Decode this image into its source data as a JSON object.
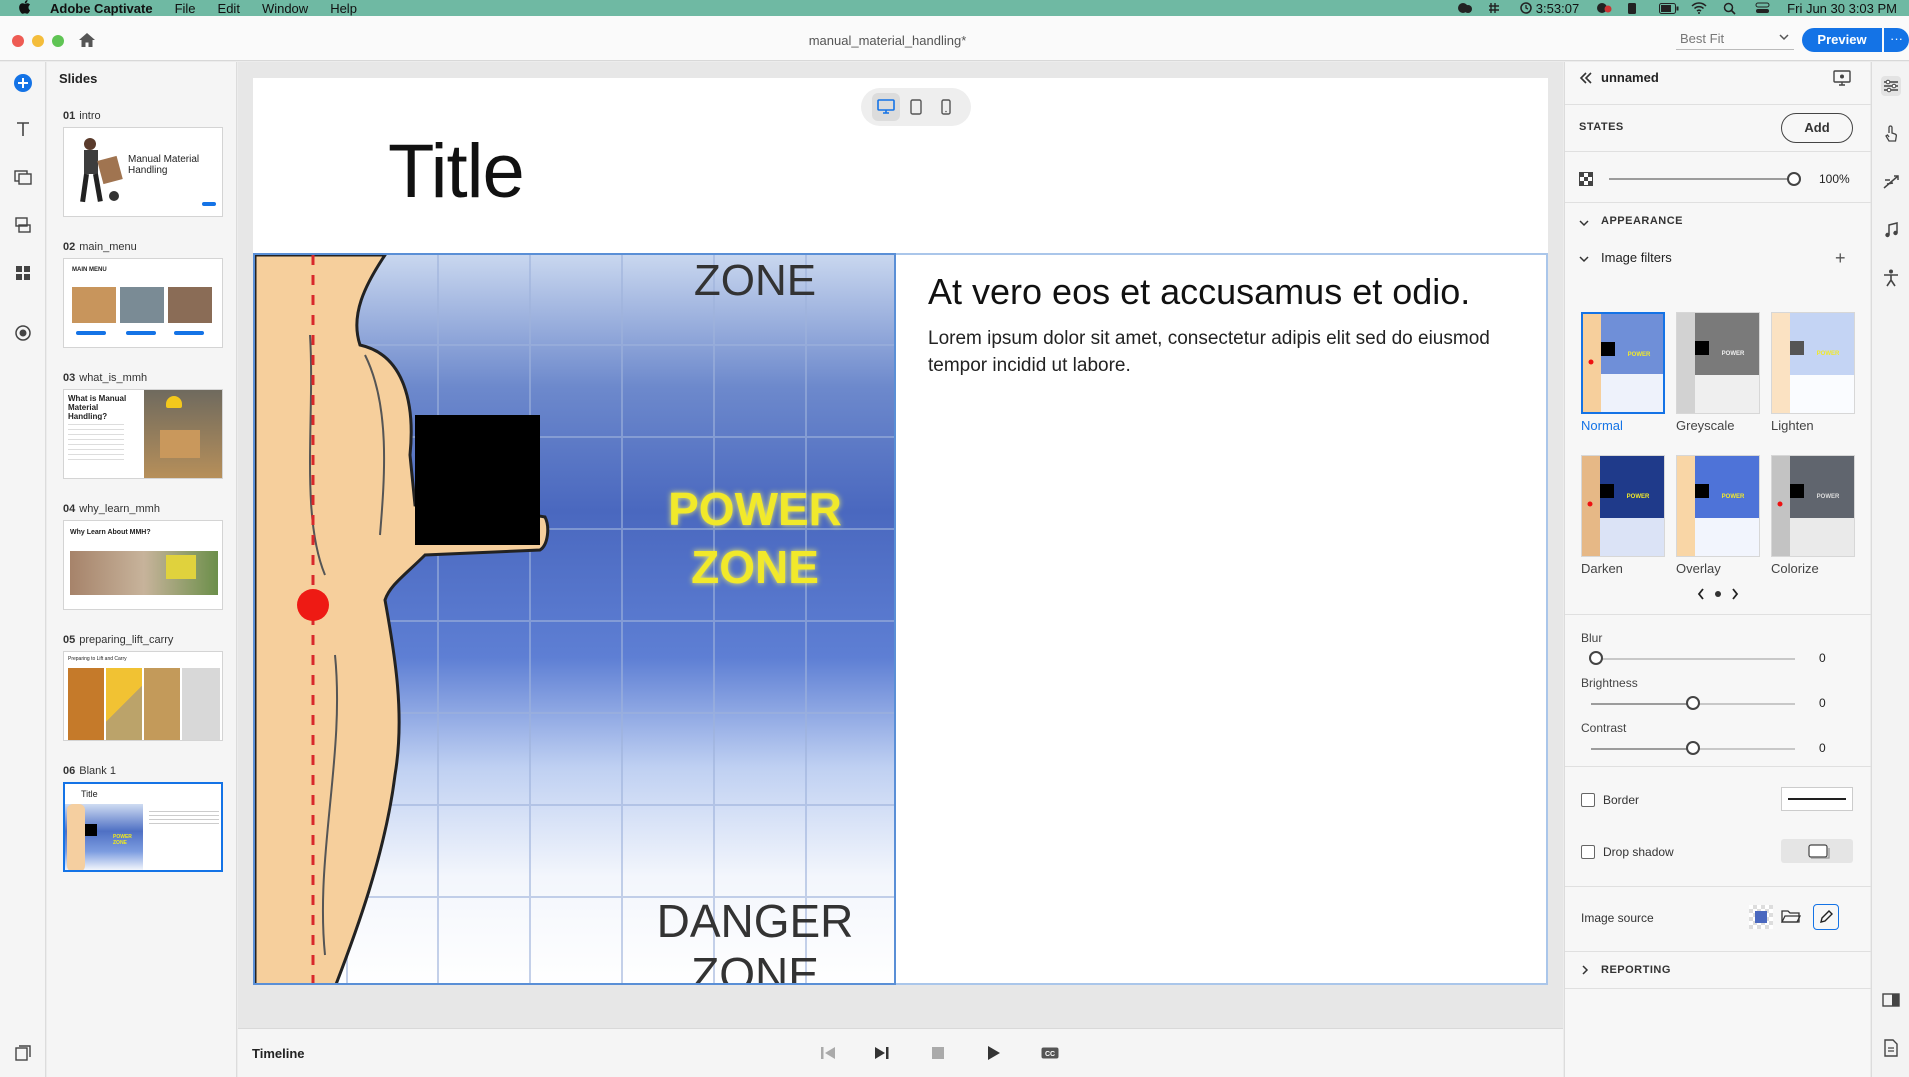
{
  "menubar": {
    "app_name": "Adobe Captivate",
    "menus": [
      "File",
      "Edit",
      "Window",
      "Help"
    ],
    "clock_timer": "3:53:07",
    "datetime": "Fri Jun 30  3:03 PM"
  },
  "window": {
    "doc_title": "manual_material_handling*",
    "zoom": "Best Fit",
    "preview_label": "Preview",
    "more_label": "···"
  },
  "slides_panel": {
    "title": "Slides",
    "slides": [
      {
        "num": "01",
        "name": "intro",
        "thumb_text": "Manual Material Handling"
      },
      {
        "num": "02",
        "name": "main_menu",
        "thumb_text": "MAIN MENU"
      },
      {
        "num": "03",
        "name": "what_is_mmh",
        "thumb_text": "What is Manual Material Handling?"
      },
      {
        "num": "04",
        "name": "why_learn_mmh",
        "thumb_text": "Why Learn About MMH?"
      },
      {
        "num": "05",
        "name": "preparing_lift_carry",
        "thumb_text": "Preparing to Lift and Carry"
      },
      {
        "num": "06",
        "name": "Blank 1",
        "thumb_text": "Title"
      }
    ]
  },
  "slide": {
    "title": "Title",
    "image_text": {
      "zone_top": "ZONE",
      "power": "POWER",
      "power_zone": "ZONE",
      "danger": "DANGER",
      "danger_zone": "ZONE"
    },
    "heading": "At vero eos et accusamus et odio.",
    "body": "Lorem ipsum dolor sit amet, consectetur adipis elit sed do eiusmod tempor incidid ut labore."
  },
  "timeline": {
    "label": "Timeline"
  },
  "properties": {
    "object_name": "unnamed",
    "states_label": "STATES",
    "add_label": "Add",
    "opacity": "100%",
    "appearance_label": "APPEARANCE",
    "image_filters_label": "Image filters",
    "filters": [
      {
        "name": "Normal",
        "active": true
      },
      {
        "name": "Greyscale",
        "active": false
      },
      {
        "name": "Lighten",
        "active": false
      },
      {
        "name": "Darken",
        "active": false
      },
      {
        "name": "Overlay",
        "active": false
      },
      {
        "name": "Colorize",
        "active": false
      }
    ],
    "blur_label": "Blur",
    "blur_value": "0",
    "brightness_label": "Brightness",
    "brightness_value": "0",
    "contrast_label": "Contrast",
    "contrast_value": "0",
    "border_label": "Border",
    "drop_shadow_label": "Drop shadow",
    "image_source_label": "Image source",
    "reporting_label": "REPORTING"
  },
  "colors": {
    "accent": "#1473e6",
    "menubar": "#6fb9a3",
    "selection": "#5a8fd6"
  }
}
